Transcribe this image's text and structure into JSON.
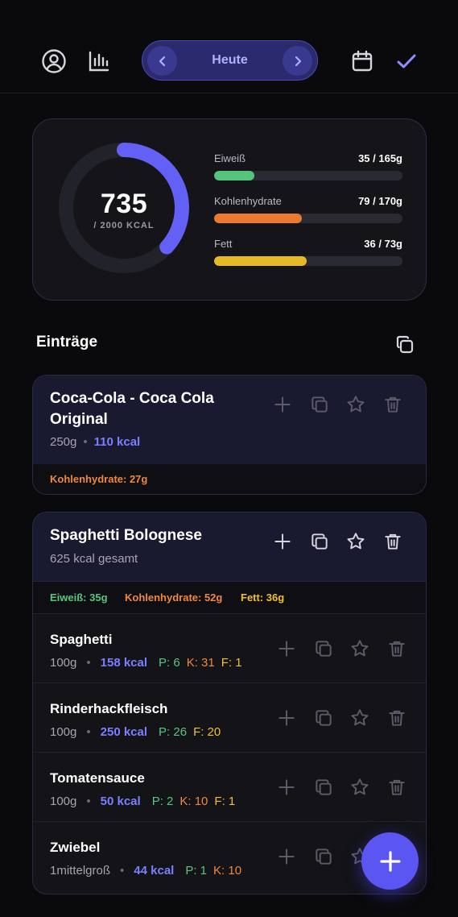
{
  "header": {
    "profile_icon": "user-circle-icon",
    "stats_icon": "bar-chart-icon",
    "date_label": "Heute",
    "calendar_icon": "calendar-icon",
    "check_icon": "check-icon"
  },
  "summary": {
    "kcal_consumed": "735",
    "kcal_goal": "/ 2000 KCAL",
    "kcal_progress": 0.3675,
    "macros": [
      {
        "name": "Eiweiß",
        "amount": "35 / 165g",
        "progress": 0.212,
        "color": "#55c47c"
      },
      {
        "name": "Kohlenhydrate",
        "amount": "79 / 170g",
        "progress": 0.465,
        "color": "#ea7a30"
      },
      {
        "name": "Fett",
        "amount": "36 / 73g",
        "progress": 0.493,
        "color": "#e6b92a"
      }
    ]
  },
  "entries_section": {
    "title": "Einträge",
    "copy_all_icon": "copy-icon"
  },
  "entries": [
    {
      "title": "Coca-Cola - Coca Cola Original",
      "amount": "250g",
      "kcal": "110 kcal",
      "carbs": "Kohlenhydrate: 27g"
    },
    {
      "title": "Spaghetti Bolognese",
      "total": "625 kcal gesamt",
      "protein": "Eiweiß: 35g",
      "carbs": "Kohlenhydrate: 52g",
      "fat": "Fett: 36g",
      "items": [
        {
          "name": "Spaghetti",
          "amount": "100g",
          "kcal": "158 kcal",
          "p": "P: 6",
          "k": "K: 31",
          "f": "F: 1"
        },
        {
          "name": "Rinderhackfleisch",
          "amount": "100g",
          "kcal": "250 kcal",
          "p": "P: 26",
          "k": "",
          "f": "F: 20"
        },
        {
          "name": "Tomatensauce",
          "amount": "100g",
          "kcal": "50 kcal",
          "p": "P: 2",
          "k": "K: 10",
          "f": "F: 1"
        },
        {
          "name": "Zwiebel",
          "amount": "1mittelgroß",
          "kcal": "44 kcal",
          "p": "P: 1",
          "k": "K: 10",
          "f": ""
        }
      ]
    }
  ],
  "fab": {
    "icon": "plus-icon"
  },
  "colors": {
    "accent": "#6366f1",
    "protein": "#55c47c",
    "carbs": "#ea7a30",
    "fat": "#e6b92a"
  }
}
